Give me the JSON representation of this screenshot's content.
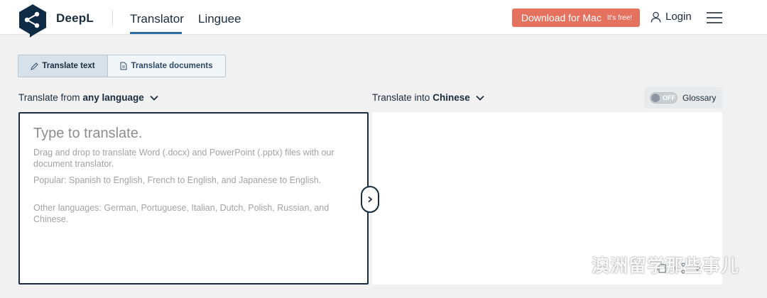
{
  "header": {
    "brand": "DeepL",
    "tabs": [
      {
        "label": "Translator",
        "active": true
      },
      {
        "label": "Linguee",
        "active": false
      }
    ],
    "download_label": "Download for Mac",
    "download_badge": "It's free!",
    "login_label": "Login"
  },
  "modes": {
    "text_label": "Translate text",
    "documents_label": "Translate documents"
  },
  "source": {
    "from_prefix": "Translate from",
    "from_language": "any language",
    "placeholder": "Type to translate.",
    "hint_drag": "Drag and drop to translate Word (.docx) and PowerPoint (.pptx) files with our document translator.",
    "hint_popular": "Popular: Spanish to English, French to English, and Japanese to English.",
    "hint_other": "Other languages: German, Portuguese, Italian, Dutch, Polish, Russian, and Chinese."
  },
  "target": {
    "into_prefix": "Translate into",
    "into_language": "Chinese",
    "glossary_toggle": "OFF",
    "glossary_label": "Glossary"
  },
  "watermark": {
    "text": "澳洲留学那些事儿"
  },
  "colors": {
    "brand_dark": "#1a2c3d",
    "accent_blue": "#2b6ea6",
    "download_orange": "#e5725f"
  }
}
